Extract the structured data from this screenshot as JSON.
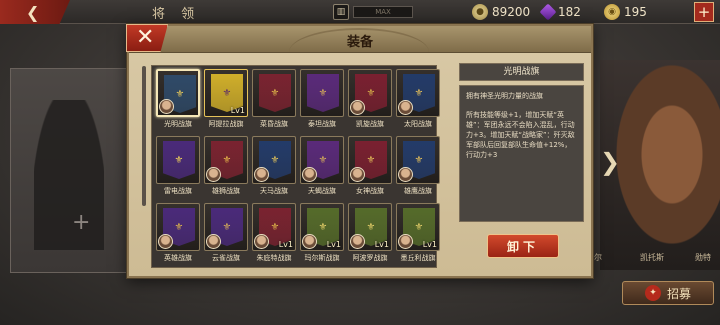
{
  "topbar": {
    "title": "将 领",
    "building_value": "MAX",
    "gold": "89200",
    "crystal": "182",
    "coin": "195",
    "back_icon": "back-arrow-icon",
    "add_icon": "plus-icon"
  },
  "background": {
    "bottom_left_label": "名门希尔",
    "bottom_right_label_1": "凯托斯",
    "bottom_right_label_2": "勋特",
    "recruit_label": "招募"
  },
  "modal": {
    "title": "装备",
    "close_icon": "close-x-icon"
  },
  "flags": [
    {
      "name": "光明战旗",
      "color": "#2f4a68",
      "emblem": "#e9c95a",
      "selected": true,
      "avatar": true
    },
    {
      "name": "阿提拉战旗",
      "color": "#cfae2a",
      "emblem": "#5a2a6a",
      "gold": true,
      "level": "Lv1"
    },
    {
      "name": "菜昏战旗",
      "color": "#7a2330",
      "emblem": "#e0b84a"
    },
    {
      "name": "泰坦战旗",
      "color": "#5a2a7a",
      "emblem": "#d8b05a"
    },
    {
      "name": "凯旋战旗",
      "color": "#7a2030",
      "emblem": "#d9b24a",
      "avatar": true
    },
    {
      "name": "太阳战旗",
      "color": "#233b69",
      "emblem": "#e6c05a",
      "avatar": true
    },
    {
      "name": "雷电战旗",
      "color": "#4a2a7a",
      "emblem": "#f1d45a"
    },
    {
      "name": "雄狮战旗",
      "color": "#7a2330",
      "emblem": "#e6b84a",
      "avatar": true
    },
    {
      "name": "天马战旗",
      "color": "#233b69",
      "emblem": "#e3c35a",
      "avatar": true
    },
    {
      "name": "天蝎战旗",
      "color": "#5a2a7a",
      "emblem": "#d8b05a",
      "avatar": true
    },
    {
      "name": "女神战旗",
      "color": "#7a2030",
      "emblem": "#e4be5a",
      "avatar": true
    },
    {
      "name": "雄鹰战旗",
      "color": "#233b69",
      "emblem": "#e6c05a",
      "avatar": true
    },
    {
      "name": "英雄战旗",
      "color": "#4a2a7a",
      "emblem": "#e0b84a",
      "avatar": true
    },
    {
      "name": "云雀战旗",
      "color": "#4a2a7a",
      "emblem": "#d8b05a",
      "avatar": true
    },
    {
      "name": "朱庇特战旗",
      "color": "#7a2330",
      "emblem": "#e0b84a",
      "avatar": true,
      "level": "Lv1"
    },
    {
      "name": "玛尔斯战旗",
      "color": "#556b2a",
      "emblem": "#e6d06a",
      "avatar": true,
      "level": "Lv1"
    },
    {
      "name": "阿波罗战旗",
      "color": "#556b2a",
      "emblem": "#e6d06a",
      "avatar": true,
      "level": "Lv1"
    },
    {
      "name": "墨丘利战旗",
      "color": "#556b2a",
      "emblem": "#e6d06a",
      "avatar": true,
      "level": "Lv1"
    }
  ],
  "detail": {
    "title": "光明战旗",
    "description": "拥有神圣光明力量的战旗",
    "effects": "所有技能等级+1，增加天赋“英雄”：军团永远不会陷入混乱，行动力+3。增加天赋“战略家”：歼灭敌军部队后回复部队生命值+12%，行动力+3"
  },
  "unequip_label": "卸下"
}
